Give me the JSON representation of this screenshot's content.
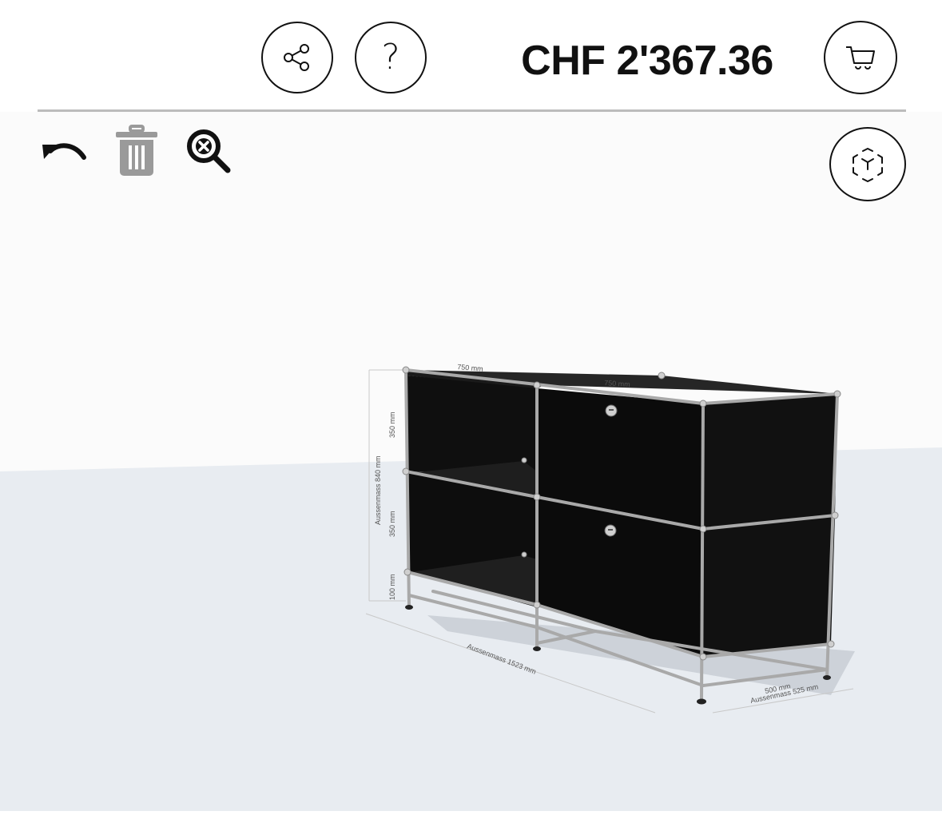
{
  "header": {
    "price": "CHF 2'367.36",
    "share_icon": "share-icon",
    "help_label": "?",
    "cart_icon": "cart-icon"
  },
  "toolbar": {
    "undo_icon": "undo-icon",
    "trash_icon": "trash-icon",
    "zoom_reset_icon": "zoom-reset-icon",
    "view3d_icon": "cube-3d-icon"
  },
  "dimensions": {
    "top_width_left": "750 mm",
    "top_width_right": "750 mm",
    "height_upper": "350 mm",
    "height_lower": "350 mm",
    "height_base": "100 mm",
    "outer_height": "Aussenmass 840 mm",
    "outer_width": "Aussenmass 1523 mm",
    "depth": "500 mm",
    "outer_depth": "Aussenmass 525 mm"
  },
  "colors": {
    "scene_bg": "#fbfbfb",
    "floor": "#e8ecf1",
    "cabinet": "#111111",
    "frame": "#a8a8a8",
    "disabled_icon": "#9a9a9a"
  }
}
